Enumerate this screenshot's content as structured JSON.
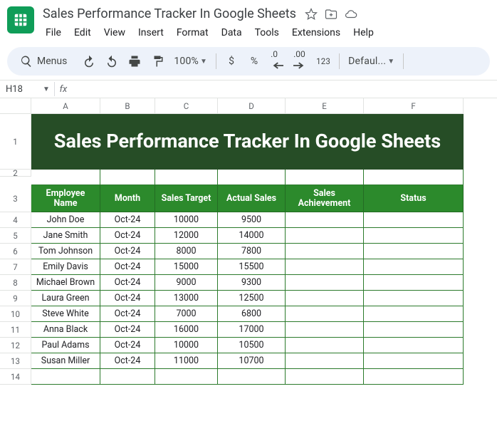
{
  "doc": {
    "title": "Sales Performance Tracker In Google Sheets"
  },
  "menus": {
    "file": "File",
    "edit": "Edit",
    "view": "View",
    "insert": "Insert",
    "format": "Format",
    "data": "Data",
    "tools": "Tools",
    "extensions": "Extensions",
    "help": "Help"
  },
  "toolbar": {
    "menus_label": "Menus",
    "zoom": "100%",
    "currency": "$",
    "percent": "%",
    "dec_dec": ".0",
    "dec_inc": ".00",
    "num123": "123",
    "font": "Defaul..."
  },
  "namebox": {
    "ref": "H18",
    "fx": "fx",
    "formula": ""
  },
  "cols": {
    "A": "A",
    "B": "B",
    "C": "C",
    "D": "D",
    "E": "E",
    "F": "F"
  },
  "rows": {
    "r1": "1",
    "r2": "2",
    "r3": "3",
    "r4": "4",
    "r5": "5",
    "r6": "6",
    "r7": "7",
    "r8": "8",
    "r9": "9",
    "r10": "10",
    "r11": "11",
    "r12": "12",
    "r13": "13",
    "r14": "14"
  },
  "sheet_title": "Sales Performance Tracker In Google Sheets",
  "headers": {
    "emp": "Employee Name",
    "month": "Month",
    "target": "Sales Target",
    "actual": "Actual Sales",
    "achieve": "Sales Achievement",
    "status": "Status"
  },
  "data": {
    "r4": {
      "name": "John Doe",
      "month": "Oct-24",
      "target": "10000",
      "actual": "9500",
      "ach": "",
      "status": ""
    },
    "r5": {
      "name": "Jane Smith",
      "month": "Oct-24",
      "target": "12000",
      "actual": "14000",
      "ach": "",
      "status": ""
    },
    "r6": {
      "name": "Tom Johnson",
      "month": "Oct-24",
      "target": "8000",
      "actual": "7800",
      "ach": "",
      "status": ""
    },
    "r7": {
      "name": "Emily Davis",
      "month": "Oct-24",
      "target": "15000",
      "actual": "15500",
      "ach": "",
      "status": ""
    },
    "r8": {
      "name": "Michael Brown",
      "month": "Oct-24",
      "target": "9000",
      "actual": "9300",
      "ach": "",
      "status": ""
    },
    "r9": {
      "name": "Laura Green",
      "month": "Oct-24",
      "target": "13000",
      "actual": "12500",
      "ach": "",
      "status": ""
    },
    "r10": {
      "name": "Steve White",
      "month": "Oct-24",
      "target": "7000",
      "actual": "6800",
      "ach": "",
      "status": ""
    },
    "r11": {
      "name": "Anna Black",
      "month": "Oct-24",
      "target": "16000",
      "actual": "17000",
      "ach": "",
      "status": ""
    },
    "r12": {
      "name": "Paul Adams",
      "month": "Oct-24",
      "target": "10000",
      "actual": "10500",
      "ach": "",
      "status": ""
    },
    "r13": {
      "name": "Susan Miller",
      "month": "Oct-24",
      "target": "11000",
      "actual": "10700",
      "ach": "",
      "status": ""
    }
  }
}
